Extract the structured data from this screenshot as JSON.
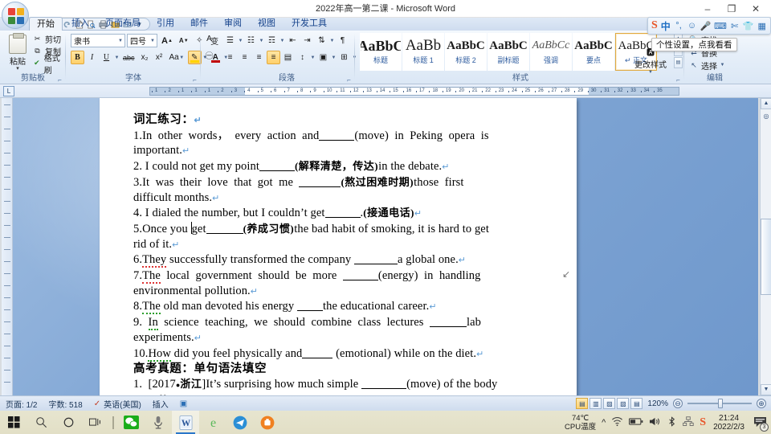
{
  "window": {
    "title": "2022年高一第二课 - Microsoft Word",
    "minimize": "–",
    "maximize": "❐",
    "close": "✕"
  },
  "quick_access": {
    "save": "💾",
    "undo": "↺",
    "redo": "↻",
    "new": "🗋",
    "print_preview": "🔍",
    "print": "🖶",
    "open": "📂",
    "email": "✉",
    "customize": "▾"
  },
  "ribbon": {
    "tabs": [
      {
        "label": "开始",
        "active": true
      },
      {
        "label": "插入",
        "active": false
      },
      {
        "label": "页面布局",
        "active": false
      },
      {
        "label": "引用",
        "active": false
      },
      {
        "label": "邮件",
        "active": false
      },
      {
        "label": "审阅",
        "active": false
      },
      {
        "label": "视图",
        "active": false
      },
      {
        "label": "开发工具",
        "active": false
      }
    ],
    "clipboard": {
      "label": "剪贴板",
      "paste": "粘贴",
      "paste_arrow": "▾",
      "cut": "剪切",
      "copy": "复制",
      "format_painter": "格式刷"
    },
    "font": {
      "label": "字体",
      "family": "隶书",
      "size": "四号",
      "grow": "A",
      "shrink": "A",
      "clear_format": "✧",
      "phonetic": "变",
      "border_char": "A",
      "enclose_char": "㊀",
      "bold": "B",
      "italic": "I",
      "underline": "U",
      "strike": "abc",
      "subscript": "x₂",
      "superscript": "x²",
      "change_case": "Aa",
      "highlight": "✎",
      "font_color": "A",
      "highlight_color": "#ffd400",
      "font_color_value": "#c00000"
    },
    "paragraph": {
      "label": "段落",
      "bullets": "☰",
      "numbering": "☷",
      "multilevel": "☶",
      "decrease_indent": "⇤",
      "increase_indent": "⇥",
      "sort": "⇅",
      "show_marks": "¶",
      "align_left": "≡",
      "align_center": "≡",
      "align_right": "≡",
      "justify": "≡",
      "distribute": "▤",
      "line_spacing": "↕",
      "shading": "▣",
      "borders": "⊞"
    },
    "styles": {
      "label": "样式",
      "items": [
        {
          "preview": "AaBbC",
          "name": "标题",
          "selected": false
        },
        {
          "preview": "AaBb",
          "name": "标题 1",
          "selected": false
        },
        {
          "preview": "AaBbC",
          "name": "标题 2",
          "selected": false
        },
        {
          "preview": "AaBbC",
          "name": "副标题",
          "selected": false
        },
        {
          "preview": "AaBbCc",
          "name": "强调",
          "selected": false
        },
        {
          "preview": "AaBbC",
          "name": "要点",
          "selected": false
        },
        {
          "preview": "AaBbC",
          "name": "正文",
          "selected": true
        }
      ],
      "change_styles": "更改样式",
      "nav_up": "▲",
      "nav_down": "▼",
      "nav_more": "▤"
    },
    "editing": {
      "label": "编辑",
      "find": "查找",
      "replace": "替换",
      "select": "选择"
    }
  },
  "ime_popup": {
    "tooltip": "个性设置，点我看看",
    "logo": "S",
    "mode": "中",
    "punctuation": "°,",
    "emoji": "☺",
    "voice": "🎤",
    "keyboard": "⌨",
    "skin": "👕",
    "tools": "▦"
  },
  "ruler": {
    "tab_stop": "L",
    "ticks": [
      1,
      2,
      1,
      1,
      1,
      2,
      3,
      4,
      5,
      6,
      7,
      8,
      9,
      10,
      11,
      12,
      13,
      14,
      15,
      16,
      17,
      18,
      19,
      20,
      21,
      22,
      23,
      24,
      25,
      26,
      27,
      28,
      29,
      30,
      31,
      32,
      33,
      34,
      35
    ]
  },
  "document": {
    "lines": [
      {
        "id": "heading-vocab",
        "chinese_bold": true,
        "text": "词汇练习："
      },
      {
        "id": "q1a",
        "text": "1.In other words， every action and______(move) in Peking opera is"
      },
      {
        "id": "q1b",
        "text": "important."
      },
      {
        "id": "q2",
        "text": "2. I could not get my point______(解释清楚，传达)in the debate."
      },
      {
        "id": "q3a",
        "text": "3.It was their love that got me _______(熬过困难时期)those first"
      },
      {
        "id": "q3b",
        "text": "difficult months."
      },
      {
        "id": "q4",
        "text": "4. I dialed the number, but I couldn't get______.(接通电话)"
      },
      {
        "id": "q5a",
        "text": "5.Once you get______(养成习惯)the bad habit of smoking, it is hard to get"
      },
      {
        "id": "q5b",
        "text": "rid of it."
      },
      {
        "id": "q6",
        "text": "6.They successfully transformed the company _______a global one."
      },
      {
        "id": "q7a",
        "text": "7.The local government should be more ______(energy) in handling"
      },
      {
        "id": "q7b",
        "text": "environmental pollution."
      },
      {
        "id": "q8",
        "text": "8.The old man devoted his energy ____the educational career."
      },
      {
        "id": "q9a",
        "text": "9. In science teaching, we should combine class lectures ______lab"
      },
      {
        "id": "q9b",
        "text": "experiments."
      },
      {
        "id": "q10",
        "text": "10.How did you feel physically and____ (emotional) while on the diet."
      },
      {
        "id": "heading-gaokao",
        "chinese_bold": true,
        "text": "高考真题：单句语法填空"
      },
      {
        "id": "g1a",
        "text": "1. [2017●浙江]It's surprising how much simple _______(move) of the body"
      },
      {
        "id": "g1b",
        "text": "can affect the way we think."
      }
    ]
  },
  "status_bar": {
    "page": "页面: 1/2",
    "words": "字数: 518",
    "language": "英语(美国)",
    "proofing_icon": "✓",
    "insert_mode": "插入",
    "macro_icon": "▣",
    "zoom": "120%",
    "views": [
      "▤",
      "▥",
      "▨",
      "▧",
      "▤"
    ],
    "zoom_out": "⊖",
    "zoom_in": "⊕"
  },
  "taskbar": {
    "start": "⊞",
    "search": "🔍",
    "cortana": "◯",
    "task_view": "▯▯",
    "apps": [
      {
        "name": "wechat",
        "glyph": "💬",
        "color": "#1aad19",
        "active": false
      },
      {
        "name": "microphone",
        "glyph": "🎙",
        "color": "#6b6b6b",
        "active": false
      },
      {
        "name": "word",
        "glyph": "W",
        "color": "#2b579a",
        "active": true
      },
      {
        "name": "browser",
        "glyph": "e",
        "color": "#5bb85b",
        "active": false
      },
      {
        "name": "telegram",
        "glyph": "➤",
        "color": "#2b8fd6",
        "active": false
      },
      {
        "name": "orange-app",
        "glyph": "◉",
        "color": "#f08020",
        "active": false
      }
    ],
    "tray": {
      "cpu_temp_value": "74℃",
      "cpu_temp_label": "CPU温度",
      "chevron": "^",
      "wifi": "📶",
      "battery": "🔋",
      "volume": "🔊",
      "bluetooth": "⚯",
      "network2": "🖧",
      "sogou": "S",
      "time": "21:24",
      "date": "2022/2/3",
      "notification_count": "3"
    }
  }
}
